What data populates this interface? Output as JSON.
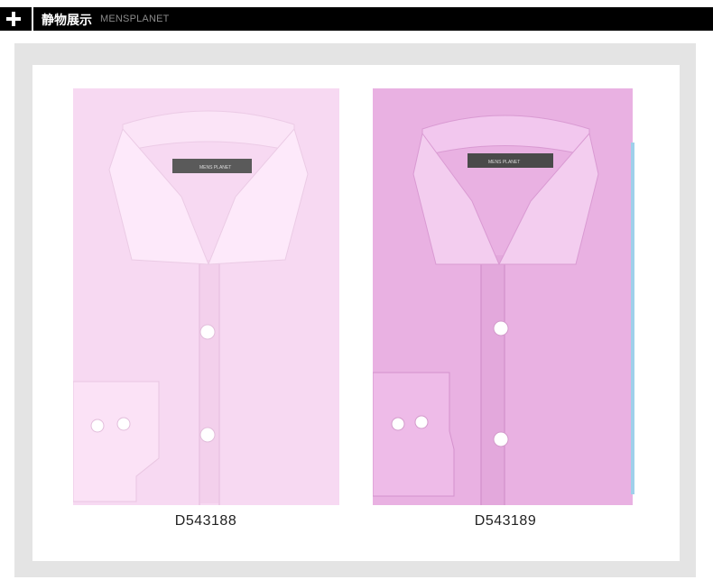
{
  "header": {
    "title_cn": "静物展示",
    "title_en": "MENSPLANET"
  },
  "products": [
    {
      "code": "D543188",
      "label_text": "MENS PLANET",
      "color": "#f7d9f2",
      "collar": "#fde7f9",
      "shade": "#ecc8e6"
    },
    {
      "code": "D543189",
      "label_text": "MENS PLANET",
      "color": "#e9b1e2",
      "collar": "#f3cdef",
      "shade": "#d99ad2"
    }
  ]
}
